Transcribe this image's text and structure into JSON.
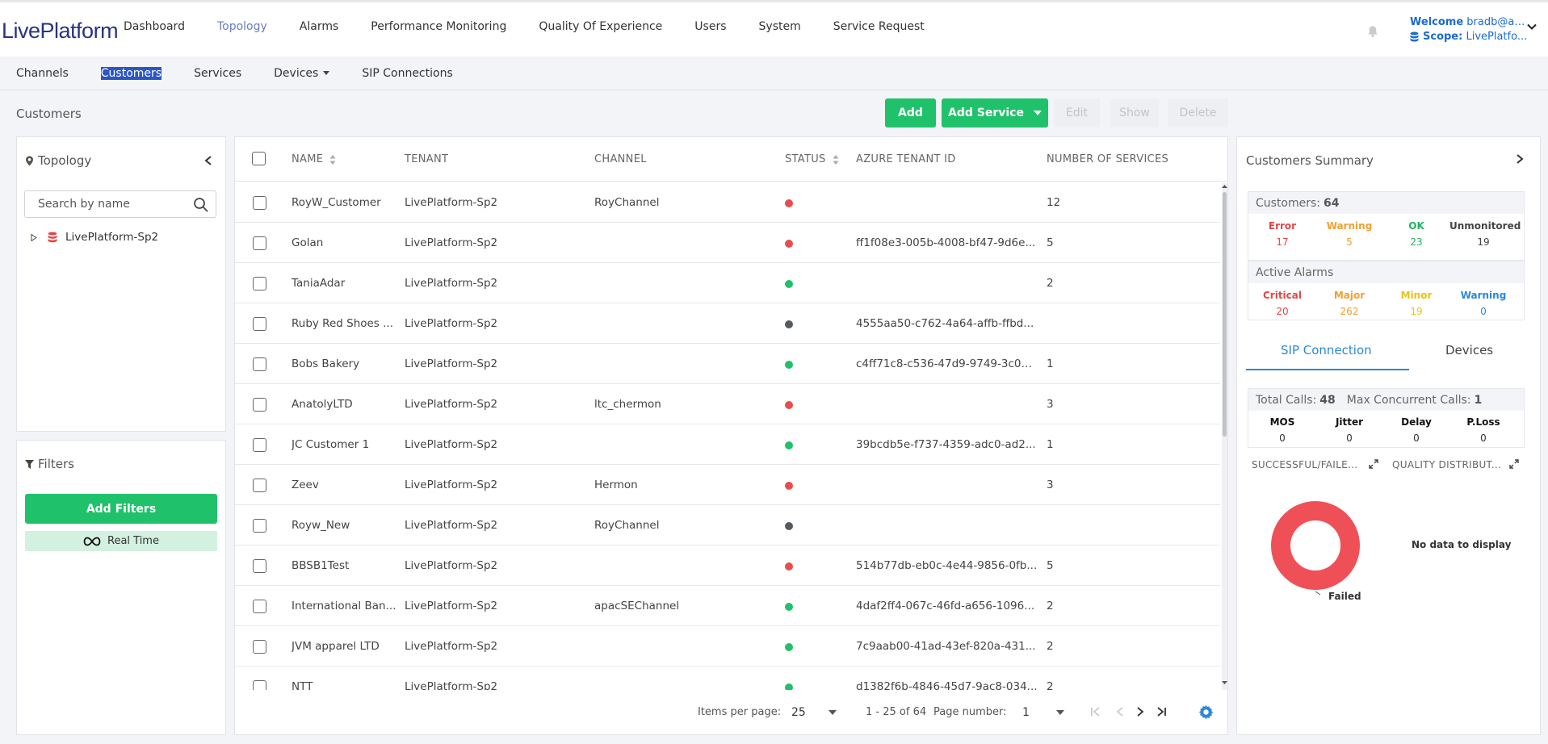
{
  "header": {
    "logo_text": "LivePlatform",
    "nav": [
      "Dashboard",
      "Topology",
      "Alarms",
      "Performance Monitoring",
      "Quality Of Experience",
      "Users",
      "System",
      "Service Request"
    ],
    "active_nav": "Topology",
    "welcome_label": "Welcome",
    "welcome_user": "bradb@au...",
    "scope_label": "Scope:",
    "scope_value": "LivePlatfo..."
  },
  "subnav": {
    "items": [
      "Channels",
      "Customers",
      "Services",
      "Devices",
      "SIP Connections"
    ],
    "active": "Customers"
  },
  "toolbar": {
    "title": "Customers",
    "add": "Add",
    "add_service": "Add Service",
    "edit": "Edit",
    "show": "Show",
    "delete": "Delete"
  },
  "topology": {
    "title": "Topology",
    "search_placeholder": "Search by name",
    "tree_root": "LivePlatform-Sp2"
  },
  "filters": {
    "title": "Filters",
    "add_filters": "Add Filters",
    "real_time": "Real Time"
  },
  "table": {
    "columns": [
      "NAME",
      "TENANT",
      "CHANNEL",
      "STATUS",
      "AZURE TENANT ID",
      "NUMBER OF SERVICES"
    ],
    "status_colors": {
      "error": "#ea4c4c",
      "ok": "#21c169",
      "unmonitored": "#555a5f"
    },
    "rows": [
      {
        "name": "RoyW_Customer",
        "tenant": "LivePlatform-Sp2",
        "channel": "RoyChannel",
        "status": "error",
        "azure": "",
        "services": "12"
      },
      {
        "name": "Golan",
        "tenant": "LivePlatform-Sp2",
        "channel": "",
        "status": "error",
        "azure": "ff1f08e3-005b-4008-bf47-9d6e...",
        "services": "5"
      },
      {
        "name": "TaniaAdar",
        "tenant": "LivePlatform-Sp2",
        "channel": "",
        "status": "ok",
        "azure": "",
        "services": "2"
      },
      {
        "name": "Ruby Red Shoes ...",
        "tenant": "LivePlatform-Sp2",
        "channel": "",
        "status": "unmonitored",
        "azure": "4555aa50-c762-4a64-affb-ffbd...",
        "services": ""
      },
      {
        "name": "Bobs Bakery",
        "tenant": "LivePlatform-Sp2",
        "channel": "",
        "status": "ok",
        "azure": "c4ff71c8-c536-47d9-9749-3c00...",
        "services": "1"
      },
      {
        "name": "AnatolyLTD",
        "tenant": "LivePlatform-Sp2",
        "channel": "ltc_chermon",
        "status": "error",
        "azure": "",
        "services": "3"
      },
      {
        "name": "JC Customer 1",
        "tenant": "LivePlatform-Sp2",
        "channel": "",
        "status": "ok",
        "azure": "39bcdb5e-f737-4359-adc0-ad2...",
        "services": "1"
      },
      {
        "name": "Zeev",
        "tenant": "LivePlatform-Sp2",
        "channel": "Hermon",
        "status": "error",
        "azure": "",
        "services": "3"
      },
      {
        "name": "Royw_New",
        "tenant": "LivePlatform-Sp2",
        "channel": "RoyChannel",
        "status": "unmonitored",
        "azure": "",
        "services": ""
      },
      {
        "name": "BBSB1Test",
        "tenant": "LivePlatform-Sp2",
        "channel": "",
        "status": "error",
        "azure": "514b77db-eb0c-4e44-9856-0fb...",
        "services": "5"
      },
      {
        "name": "International Ban...",
        "tenant": "LivePlatform-Sp2",
        "channel": "apacSEChannel",
        "status": "ok",
        "azure": "4daf2ff4-067c-46fd-a656-1096...",
        "services": "2"
      },
      {
        "name": "JVM apparel LTD",
        "tenant": "LivePlatform-Sp2",
        "channel": "",
        "status": "ok",
        "azure": "7c9aab00-41ad-43ef-820a-431...",
        "services": "2"
      },
      {
        "name": "NTT",
        "tenant": "LivePlatform-Sp2",
        "channel": "",
        "status": "ok",
        "azure": "d1382f6b-4846-45d7-9ac8-034...",
        "services": "2"
      }
    ]
  },
  "pager": {
    "items_label": "Items per page:",
    "items_value": "25",
    "range": "1 - 25 of 64",
    "page_label": "Page number:",
    "page_value": "1"
  },
  "summary": {
    "title": "Customers Summary",
    "customers_label": "Customers:",
    "customers_count": "64",
    "customer_stats": [
      {
        "label": "Error",
        "value": "17",
        "color": "#e64545"
      },
      {
        "label": "Warning",
        "value": "5",
        "color": "#f0a030"
      },
      {
        "label": "OK",
        "value": "23",
        "color": "#1fb560"
      },
      {
        "label": "Unmonitored",
        "value": "19",
        "color": "#444444"
      }
    ],
    "alarms_label": "Active Alarms",
    "alarm_stats": [
      {
        "label": "Critical",
        "value": "20",
        "color": "#e64545"
      },
      {
        "label": "Major",
        "value": "262",
        "color": "#f0a030"
      },
      {
        "label": "Minor",
        "value": "19",
        "color": "#e8c21a"
      },
      {
        "label": "Warning",
        "value": "0",
        "color": "#2b88d8"
      }
    ],
    "tabs": [
      "SIP Connection",
      "Devices"
    ],
    "active_tab": "SIP Connection",
    "total_calls_label": "Total Calls:",
    "total_calls": "48",
    "max_calls_label": "Max Concurrent Calls:",
    "max_calls": "1",
    "metrics": [
      {
        "label": "MOS",
        "value": "0"
      },
      {
        "label": "Jitter",
        "value": "0"
      },
      {
        "label": "Delay",
        "value": "0"
      },
      {
        "label": "P.Loss",
        "value": "0"
      }
    ],
    "chart1_title": "SUCCESSFUL/FAILE...",
    "chart2_title": "QUALITY DISTRIBUT...",
    "donut_label": "Failed",
    "no_data": "No data to display"
  }
}
